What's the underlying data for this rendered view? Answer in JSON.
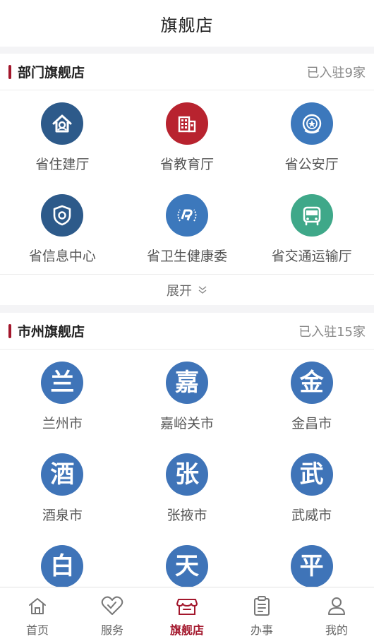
{
  "header": {
    "title": "旗舰店"
  },
  "departments": {
    "title": "部门旗舰店",
    "count": "已入驻9家",
    "expand_label": "展开",
    "items": [
      {
        "label": "省住建厅",
        "icon": "house-icon",
        "color": "#2d5a8a"
      },
      {
        "label": "省教育厅",
        "icon": "building-icon",
        "color": "#b8232f"
      },
      {
        "label": "省公安厅",
        "icon": "police-badge-icon",
        "color": "#3c78bc"
      },
      {
        "label": "省信息中心",
        "icon": "shield-icon",
        "color": "#2d5a8a"
      },
      {
        "label": "省卫生健康委",
        "icon": "health-emblem-icon",
        "color": "#3c78bc"
      },
      {
        "label": "省交通运输厅",
        "icon": "bus-icon",
        "color": "#3fa889"
      }
    ]
  },
  "cities": {
    "title": "市州旗舰店",
    "count": "已入驻15家",
    "items": [
      {
        "char": "兰",
        "label": "兰州市"
      },
      {
        "char": "嘉",
        "label": "嘉峪关市"
      },
      {
        "char": "金",
        "label": "金昌市"
      },
      {
        "char": "酒",
        "label": "酒泉市"
      },
      {
        "char": "张",
        "label": "张掖市"
      },
      {
        "char": "武",
        "label": "武威市"
      },
      {
        "char": "白",
        "label": ""
      },
      {
        "char": "天",
        "label": ""
      },
      {
        "char": "平",
        "label": ""
      }
    ]
  },
  "tabbar": {
    "items": [
      {
        "label": "首页",
        "icon": "home-icon"
      },
      {
        "label": "服务",
        "icon": "heart-icon"
      },
      {
        "label": "旗舰店",
        "icon": "store-icon",
        "active": true
      },
      {
        "label": "办事",
        "icon": "clipboard-icon"
      },
      {
        "label": "我的",
        "icon": "user-icon"
      }
    ]
  },
  "colors": {
    "accent": "#a3172c",
    "city_circle": "#3f74b8"
  }
}
